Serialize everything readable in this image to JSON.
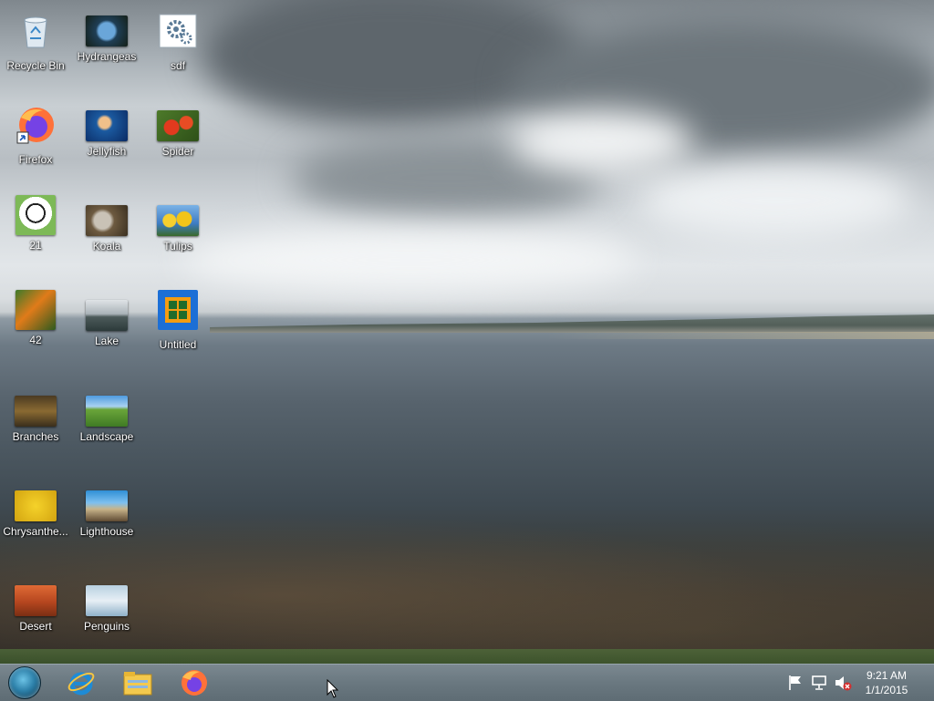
{
  "desktop": {
    "icons": [
      {
        "label": "Recycle Bin",
        "icon": "recycle-bin-icon"
      },
      {
        "label": "Hydrangeas",
        "icon": "image-file-icon"
      },
      {
        "label": "sdf",
        "icon": "settings-file-icon"
      },
      {
        "label": "Firefox",
        "icon": "firefox-shortcut-icon"
      },
      {
        "label": "Jellyfish",
        "icon": "image-file-icon"
      },
      {
        "label": "Spider",
        "icon": "image-file-icon"
      },
      {
        "label": "21",
        "icon": "image-file-icon"
      },
      {
        "label": "Koala",
        "icon": "image-file-icon"
      },
      {
        "label": "Tulips",
        "icon": "image-file-icon"
      },
      {
        "label": "42",
        "icon": "image-file-icon"
      },
      {
        "label": "Lake",
        "icon": "image-file-icon"
      },
      {
        "label": "Untitled",
        "icon": "app-icon"
      },
      {
        "label": "Branches",
        "icon": "image-file-icon"
      },
      {
        "label": "Landscape",
        "icon": "image-file-icon"
      },
      {
        "label": "Chrysanthe...",
        "icon": "image-file-icon"
      },
      {
        "label": "Lighthouse",
        "icon": "image-file-icon"
      },
      {
        "label": "Desert",
        "icon": "image-file-icon"
      },
      {
        "label": "Penguins",
        "icon": "image-file-icon"
      }
    ]
  },
  "taskbar": {
    "pinned": [
      "start-orb-icon",
      "internet-explorer-icon",
      "file-explorer-icon",
      "firefox-icon"
    ],
    "tray_icons": [
      "action-center-flag-icon",
      "network-icon",
      "volume-muted-icon"
    ],
    "clock": {
      "time": "9:21 AM",
      "date": "1/1/2015"
    }
  },
  "colors": {
    "taskbar": "#6a7880",
    "label_text": "#ffffff"
  }
}
